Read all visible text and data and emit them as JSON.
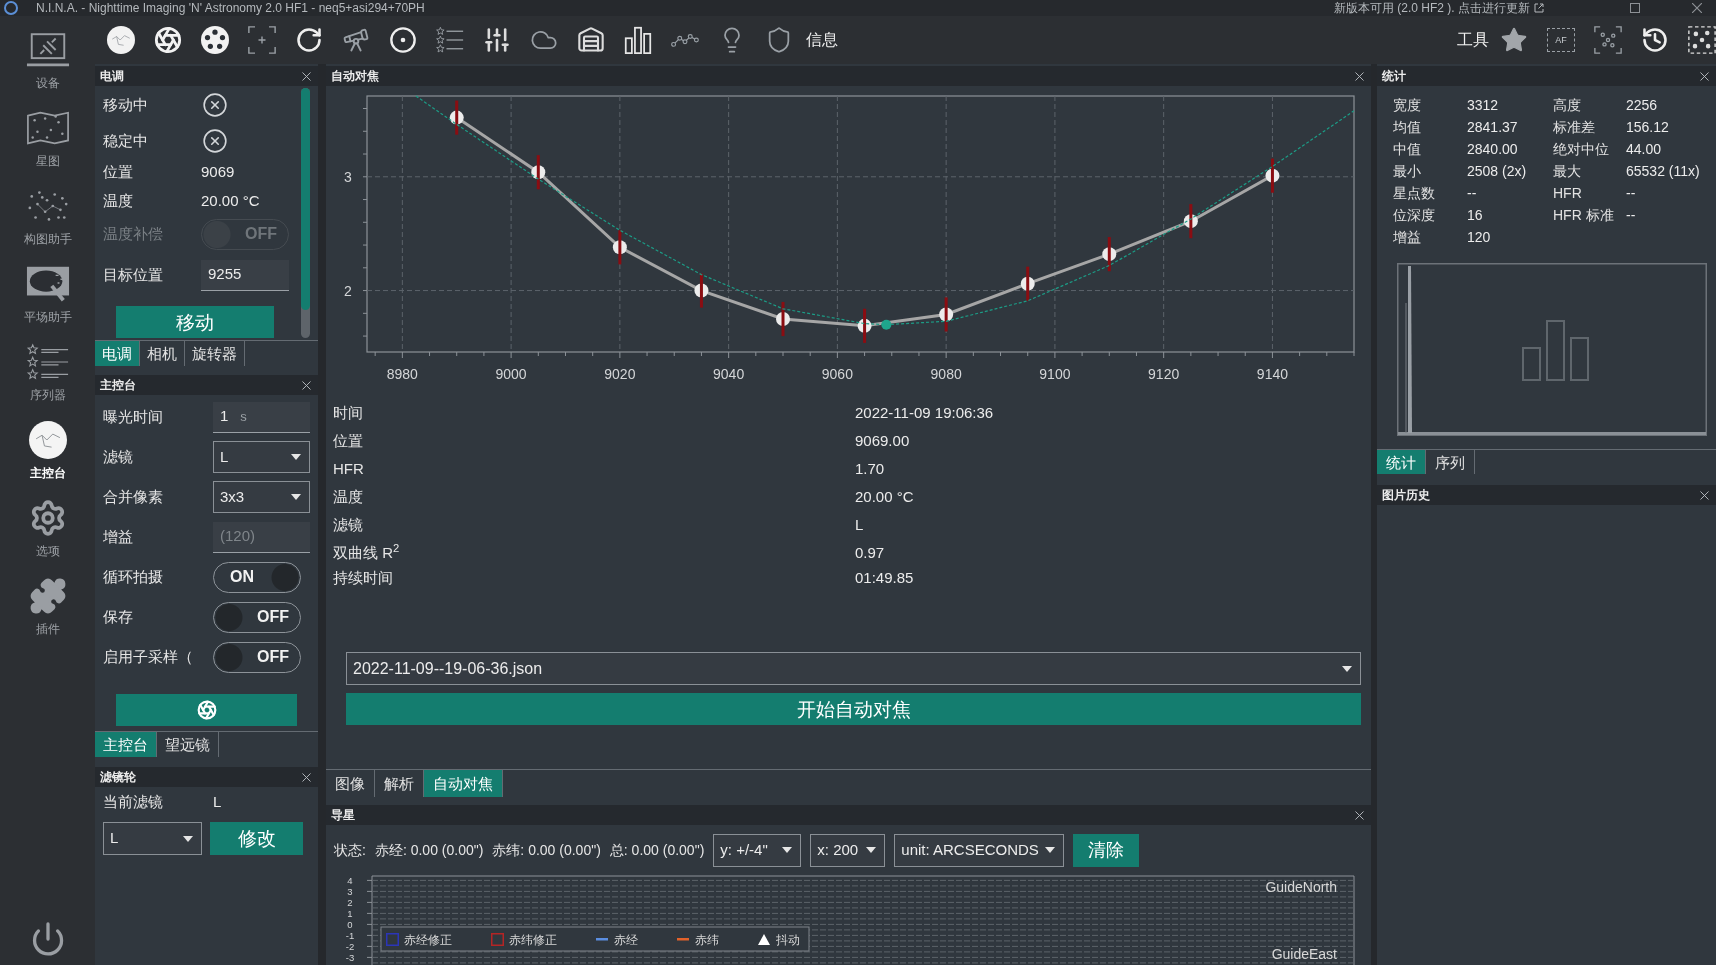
{
  "window": {
    "title": "N.I.N.A. - Nighttime Imaging 'N' Astronomy 2.0 HF1 - neq5+asi294+70PH",
    "notice": "新版本可用 (2.0 HF2 ). 点击进行更新"
  },
  "nav": [
    {
      "label": "设备",
      "kind": "equipment",
      "selected": false
    },
    {
      "label": "星图",
      "kind": "skychart",
      "selected": false
    },
    {
      "label": "构图助手",
      "kind": "framing",
      "selected": false
    },
    {
      "label": "平场助手",
      "kind": "flats",
      "selected": false
    },
    {
      "label": "序列器",
      "kind": "sequencer",
      "selected": false
    },
    {
      "label": "主控台",
      "kind": "imaging",
      "selected": true
    },
    {
      "label": "选项",
      "kind": "options",
      "selected": false
    },
    {
      "label": "插件",
      "kind": "plugins",
      "selected": false
    }
  ],
  "toolbar": {
    "info_label": "信息",
    "tools_label": "工具",
    "af_label": "AF"
  },
  "focuser": {
    "title": "电调",
    "rows": [
      {
        "label": "移动中",
        "kind": "status",
        "on": false
      },
      {
        "label": "稳定中",
        "kind": "status",
        "on": false
      },
      {
        "label": "位置",
        "kind": "value",
        "value": "9069"
      },
      {
        "label": "温度",
        "kind": "value",
        "value": "20.00 °C"
      },
      {
        "label": "温度补偿",
        "kind": "toggle",
        "on": false,
        "disabled": true,
        "state_text": "OFF"
      },
      {
        "label": "目标位置",
        "kind": "input",
        "value": "9255"
      }
    ],
    "move_button": "移动",
    "tabs": [
      {
        "label": "电调",
        "selected": true
      },
      {
        "label": "相机",
        "selected": false
      },
      {
        "label": "旋转器",
        "selected": false
      }
    ]
  },
  "imaging": {
    "title": "主控台",
    "rows": [
      {
        "label": "曝光时间",
        "kind": "input",
        "value": "1",
        "unit": "s"
      },
      {
        "label": "滤镜",
        "kind": "select",
        "value": "L"
      },
      {
        "label": "合并像素",
        "kind": "select",
        "value": "3x3"
      },
      {
        "label": "增益",
        "kind": "input",
        "placeholder": "(120)"
      },
      {
        "label": "循环拍摄",
        "kind": "toggle",
        "on": true,
        "state_text": "ON"
      },
      {
        "label": "保存",
        "kind": "toggle",
        "on": false,
        "state_text": "OFF"
      },
      {
        "label": "启用子采样（",
        "kind": "toggle",
        "on": false,
        "state_text": "OFF"
      }
    ],
    "tabs": [
      {
        "label": "主控台",
        "selected": true
      },
      {
        "label": "望远镜",
        "selected": false
      }
    ]
  },
  "filter_wheel": {
    "title": "滤镜轮",
    "current_label": "当前滤镜",
    "current_value": "L",
    "select": {
      "value": "L"
    },
    "change_button": "修改"
  },
  "autofocus": {
    "title": "自动对焦",
    "chart_data": {
      "type": "line",
      "grid": true,
      "x": [
        8982.5,
        8990,
        9005,
        9020,
        9035,
        9050,
        9065,
        9069,
        9080,
        9095,
        9110,
        9125,
        9140,
        9155
      ],
      "series": [
        {
          "color": "#a6a6a6",
          "marker": "circle",
          "values": [
            null,
            3.52,
            3.04,
            2.38,
            2.0,
            1.75,
            1.69,
            null,
            1.79,
            2.06,
            2.32,
            2.61,
            3.01,
            null
          ],
          "errors": [
            null,
            0.15,
            0.15,
            0.15,
            0.15,
            0.15,
            0.15,
            null,
            0.15,
            0.15,
            0.15,
            0.15,
            0.15,
            null
          ]
        },
        {
          "color": "#1c9c86",
          "line_style": "dashed",
          "values": [
            3.71,
            3.46,
            2.98,
            2.53,
            2.14,
            1.84,
            1.71,
            1.7,
            1.73,
            1.91,
            2.22,
            2.63,
            3.09,
            3.58
          ]
        },
        {
          "color": "#1fa58c",
          "marker": "dot",
          "values": [
            null,
            null,
            null,
            null,
            null,
            null,
            null,
            1.7,
            null,
            null,
            null,
            null,
            null,
            null
          ]
        }
      ],
      "xlim": [
        8973.5,
        9155
      ],
      "ylim": [
        1.46,
        3.71
      ],
      "xticks": [
        8980,
        9000,
        9020,
        9040,
        9060,
        9080,
        9100,
        9120,
        9140
      ],
      "yticks": [
        2,
        3
      ]
    },
    "info": [
      {
        "label": "时间",
        "value": "2022-11-09 19:06:36"
      },
      {
        "label": "位置",
        "value": "9069.00"
      },
      {
        "label": "HFR",
        "value": "1.70"
      },
      {
        "label": "温度",
        "value": "20.00 °C"
      },
      {
        "label": "滤镜",
        "value": "L"
      },
      {
        "label": "双曲线 R$^{2}$",
        "value": "0.97"
      },
      {
        "label": "持续时间",
        "value": "01:49.85"
      }
    ],
    "file_select": {
      "value": "2022-11-09--19-06-36.json"
    },
    "start_button": "开始自动对焦"
  },
  "center_tabs": [
    {
      "label": "图像",
      "selected": false
    },
    {
      "label": "解析",
      "selected": false
    },
    {
      "label": "自动对焦",
      "selected": true
    }
  ],
  "guider": {
    "title": "导星",
    "status_label": "状态:",
    "readings": [
      "赤经: 0.00 (0.00\")",
      "赤纬: 0.00 (0.00\")",
      "总: 0.00 (0.00\")"
    ],
    "selects": [
      {
        "value": "y: +/-4\""
      },
      {
        "value": "x: 200"
      },
      {
        "value": "unit: ARCSECONDS"
      }
    ],
    "clear_button": "清除",
    "chart_data": {
      "type": "line",
      "grid": true,
      "ylim": [
        -3.6,
        4.4
      ],
      "yticks": [
        4,
        3,
        2,
        1,
        0,
        -1,
        -2,
        -3
      ],
      "series": [
        {
          "name": "赤经修正",
          "marker": "square",
          "color": "#2b35b8"
        },
        {
          "name": "赤纬修正",
          "marker": "square",
          "color": "#b42525"
        },
        {
          "name": "赤经",
          "color": "#5b8ee0"
        },
        {
          "name": "赤纬",
          "color": "#e2622b"
        },
        {
          "name": "抖动",
          "marker": "triangle",
          "color": "#ffffff"
        }
      ],
      "annotations": [
        {
          "text": "GuideNorth"
        },
        {
          "text": "GuideEast"
        }
      ]
    }
  },
  "statistics": {
    "title": "统计",
    "rows": [
      [
        {
          "label": "宽度",
          "value": "3312"
        },
        {
          "label": "高度",
          "value": "2256"
        }
      ],
      [
        {
          "label": "均值",
          "value": "2841.37"
        },
        {
          "label": "标准差",
          "value": "156.12"
        }
      ],
      [
        {
          "label": "中值",
          "value": "2840.00"
        },
        {
          "label": "绝对中位",
          "value": "44.00"
        }
      ],
      [
        {
          "label": "最小",
          "value": "2508 (2x)"
        },
        {
          "label": "最大",
          "value": "65532 (11x)"
        }
      ],
      [
        {
          "label": "星点数",
          "value": "--"
        },
        {
          "label": "HFR",
          "value": "--"
        }
      ],
      [
        {
          "label": "位深度",
          "value": "16"
        },
        {
          "label": "HFR 标准",
          "value": "--"
        }
      ],
      [
        {
          "label": "增益",
          "value": "120"
        }
      ]
    ],
    "tabs": [
      {
        "label": "统计",
        "selected": true
      },
      {
        "label": "序列",
        "selected": false
      }
    ]
  },
  "image_history": {
    "title": "图片历史"
  }
}
